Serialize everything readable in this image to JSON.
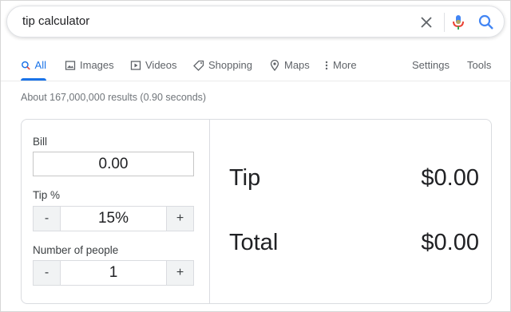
{
  "search": {
    "query": "tip calculator"
  },
  "tabs": [
    {
      "label": "All",
      "icon": "search-icon",
      "active": true
    },
    {
      "label": "Images",
      "icon": "image-icon"
    },
    {
      "label": "Videos",
      "icon": "video-icon"
    },
    {
      "label": "Shopping",
      "icon": "tag-icon"
    },
    {
      "label": "Maps",
      "icon": "map-pin-icon"
    },
    {
      "label": "More",
      "icon": "more-vert-icon"
    }
  ],
  "tools": {
    "settings_label": "Settings",
    "tools_label": "Tools"
  },
  "stats": "About 167,000,000 results (0.90 seconds)",
  "calculator": {
    "bill_label": "Bill",
    "bill_value": "0.00",
    "tip_label": "Tip %",
    "tip_value": "15%",
    "people_label": "Number of people",
    "people_value": "1",
    "minus": "-",
    "plus": "+",
    "tip_result_label": "Tip",
    "tip_result_value": "$0.00",
    "total_label": "Total",
    "total_value": "$0.00"
  },
  "colors": {
    "accent": "#1a73e8",
    "mic_red": "#ea4335",
    "text": "#202124",
    "muted": "#5f6368"
  }
}
